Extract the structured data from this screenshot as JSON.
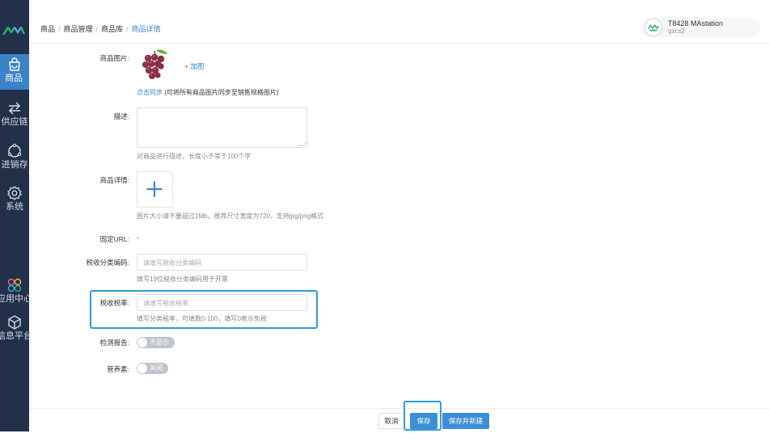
{
  "breadcrumb": {
    "items": [
      "商品",
      "商品管理",
      "商品库"
    ],
    "current": "商品详情"
  },
  "account": {
    "name": "T8428 MAstation",
    "sub": "qzcs2"
  },
  "sidebar": {
    "items": [
      {
        "label": "商品",
        "icon": "shopping-bag-icon",
        "active": true
      },
      {
        "label": "供应链",
        "icon": "swap-arrows-icon"
      },
      {
        "label": "进销存",
        "icon": "cycle-icon"
      },
      {
        "label": "系统",
        "icon": "gear-icon"
      },
      {
        "label": "应用中心",
        "icon": "apps-icon"
      },
      {
        "label": "信息平台",
        "icon": "cube-icon"
      }
    ]
  },
  "form": {
    "images": {
      "label": "商品图片:",
      "add_label": "+ 加图",
      "sync_link": "点击同步",
      "sync_note": "(可将所有商品图片同步至销售规格图片)"
    },
    "description": {
      "label": "描述:",
      "hint": "对商品进行描述，长度小于等于100个字"
    },
    "detail": {
      "label": "商品详情:",
      "hint": "图片大小请不要超过1Mb，推荐尺寸宽度为720，支持jpg/png格式"
    },
    "fixed_url": {
      "label": "固定URL:",
      "value": "-"
    },
    "tax_code": {
      "label": "税收分类编码:",
      "placeholder": "请填写税收分类编码",
      "hint": "填写19位税收分类编码用于开票"
    },
    "tax_rate": {
      "label": "税收税率:",
      "placeholder": "请填写税收税率",
      "hint": "填写分类税率，可填数0-100，填写0表示免税"
    },
    "inspection_report": {
      "label": "检测报告:",
      "switch_text": "不显示"
    },
    "nutrients": {
      "label": "营养素:",
      "switch_text": "关闭"
    }
  },
  "footer": {
    "cancel": "取消",
    "save": "保存",
    "save_new": "保存并新建"
  },
  "colors": {
    "sidebar_bg": "#22304a",
    "accent": "#3b82c9",
    "highlight": "#2f9be0"
  }
}
